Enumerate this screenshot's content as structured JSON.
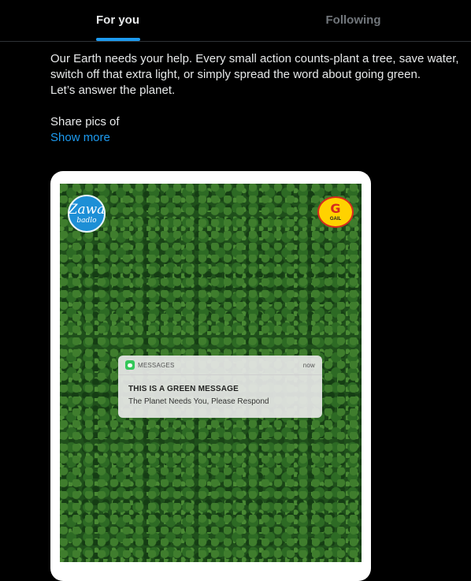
{
  "tabs": [
    {
      "label": "For you",
      "active": true
    },
    {
      "label": "Following",
      "active": false
    }
  ],
  "tweet": {
    "line1": "Our Earth needs your help. Every small action counts-plant a tree, save water, switch off that extra light, or simply spread the word about going green.",
    "line2": "Let’s answer the planet.",
    "line3": "Share pics of",
    "show_more": "Show more"
  },
  "media": {
    "logo_left": {
      "big": "Zawa",
      "small": "badlo"
    },
    "logo_right": {
      "mark": "G",
      "word": "GAIL"
    },
    "notification": {
      "app": "MESSAGES",
      "time": "now",
      "title": "THIS IS A GREEN MESSAGE",
      "body": "The Planet Needs You, Please Respond"
    }
  },
  "colors": {
    "accent": "#1d9bf0",
    "background": "#000000",
    "text": "#e7e9ea",
    "muted": "#71767b"
  }
}
